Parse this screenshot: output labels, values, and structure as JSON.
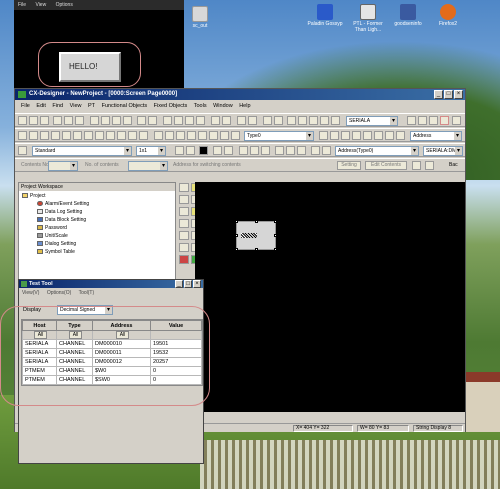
{
  "desktop": {
    "icons": [
      {
        "label": "sc_out",
        "color": "#d8d8d8"
      },
      {
        "label": "Paladin Gossyp",
        "color": "#2a5ac9"
      },
      {
        "label": "PTL - Former Than Ligh...",
        "color": "#e5e5e5"
      },
      {
        "label": "goodseninfo",
        "color": "#3a5aa0"
      },
      {
        "label": "Firefox2",
        "color": "#e36b1b"
      }
    ]
  },
  "preview": {
    "menu": [
      "File",
      "View",
      "Options"
    ],
    "button_label": "HELLO!"
  },
  "window": {
    "title": "CX-Designer - NewProject - [0000:Screen Page0000]",
    "menu": [
      "File",
      "Edit",
      "Find",
      "View",
      "PT",
      "Functional Objects",
      "Fixed Objects",
      "Tools",
      "Window",
      "Help"
    ],
    "toolbar": {
      "type_combo": "Type0",
      "serial_combo": "SERIALA",
      "address_combo": "Address",
      "style_combo": "Standard",
      "scale_combo": "1x1",
      "address_type_combo": "Address(Type0)",
      "serial_dm_combo": "SERIALA:DM",
      "contents_no_label": "Contents No.",
      "no_contents_label": "No. of contents",
      "address_switching_label": "Address for switching contents",
      "setting_button": "Setting",
      "edit_contents_button": "Edit Contents",
      "back_label": "Bac"
    },
    "workspace": {
      "title": "Project Workspace",
      "items": [
        "Project",
        "Alarm/Event Setting",
        "Data Log Setting",
        "Data Block Setting",
        "Password",
        "Unit/Scale",
        "Dialog Setting",
        "Symbol Table"
      ]
    },
    "status": {
      "position": "X= 404 Y= 322",
      "size": "W= 80 Y= 83",
      "object": "String Display 8"
    }
  },
  "testtool": {
    "title": "Test Tool",
    "menu": [
      "View(V)",
      "Options(O)",
      "Tool(T)"
    ],
    "display_label": "Display",
    "display_value": "Decimal Signed",
    "columns": [
      "Host",
      "Type",
      "Address",
      "Value"
    ],
    "filters": [
      "All",
      "All",
      "All",
      ""
    ],
    "rows": [
      [
        "SERIALA",
        "CHANNEL",
        "DM000010",
        "19501"
      ],
      [
        "SERIALA",
        "CHANNEL",
        "DM000011",
        "19532"
      ],
      [
        "SERIALA",
        "CHANNEL",
        "DM000012",
        "20257"
      ],
      [
        "PTMEM",
        "CHANNEL",
        "$W0",
        "0"
      ],
      [
        "PTMEM",
        "CHANNEL",
        "$SW0",
        "0"
      ]
    ]
  }
}
